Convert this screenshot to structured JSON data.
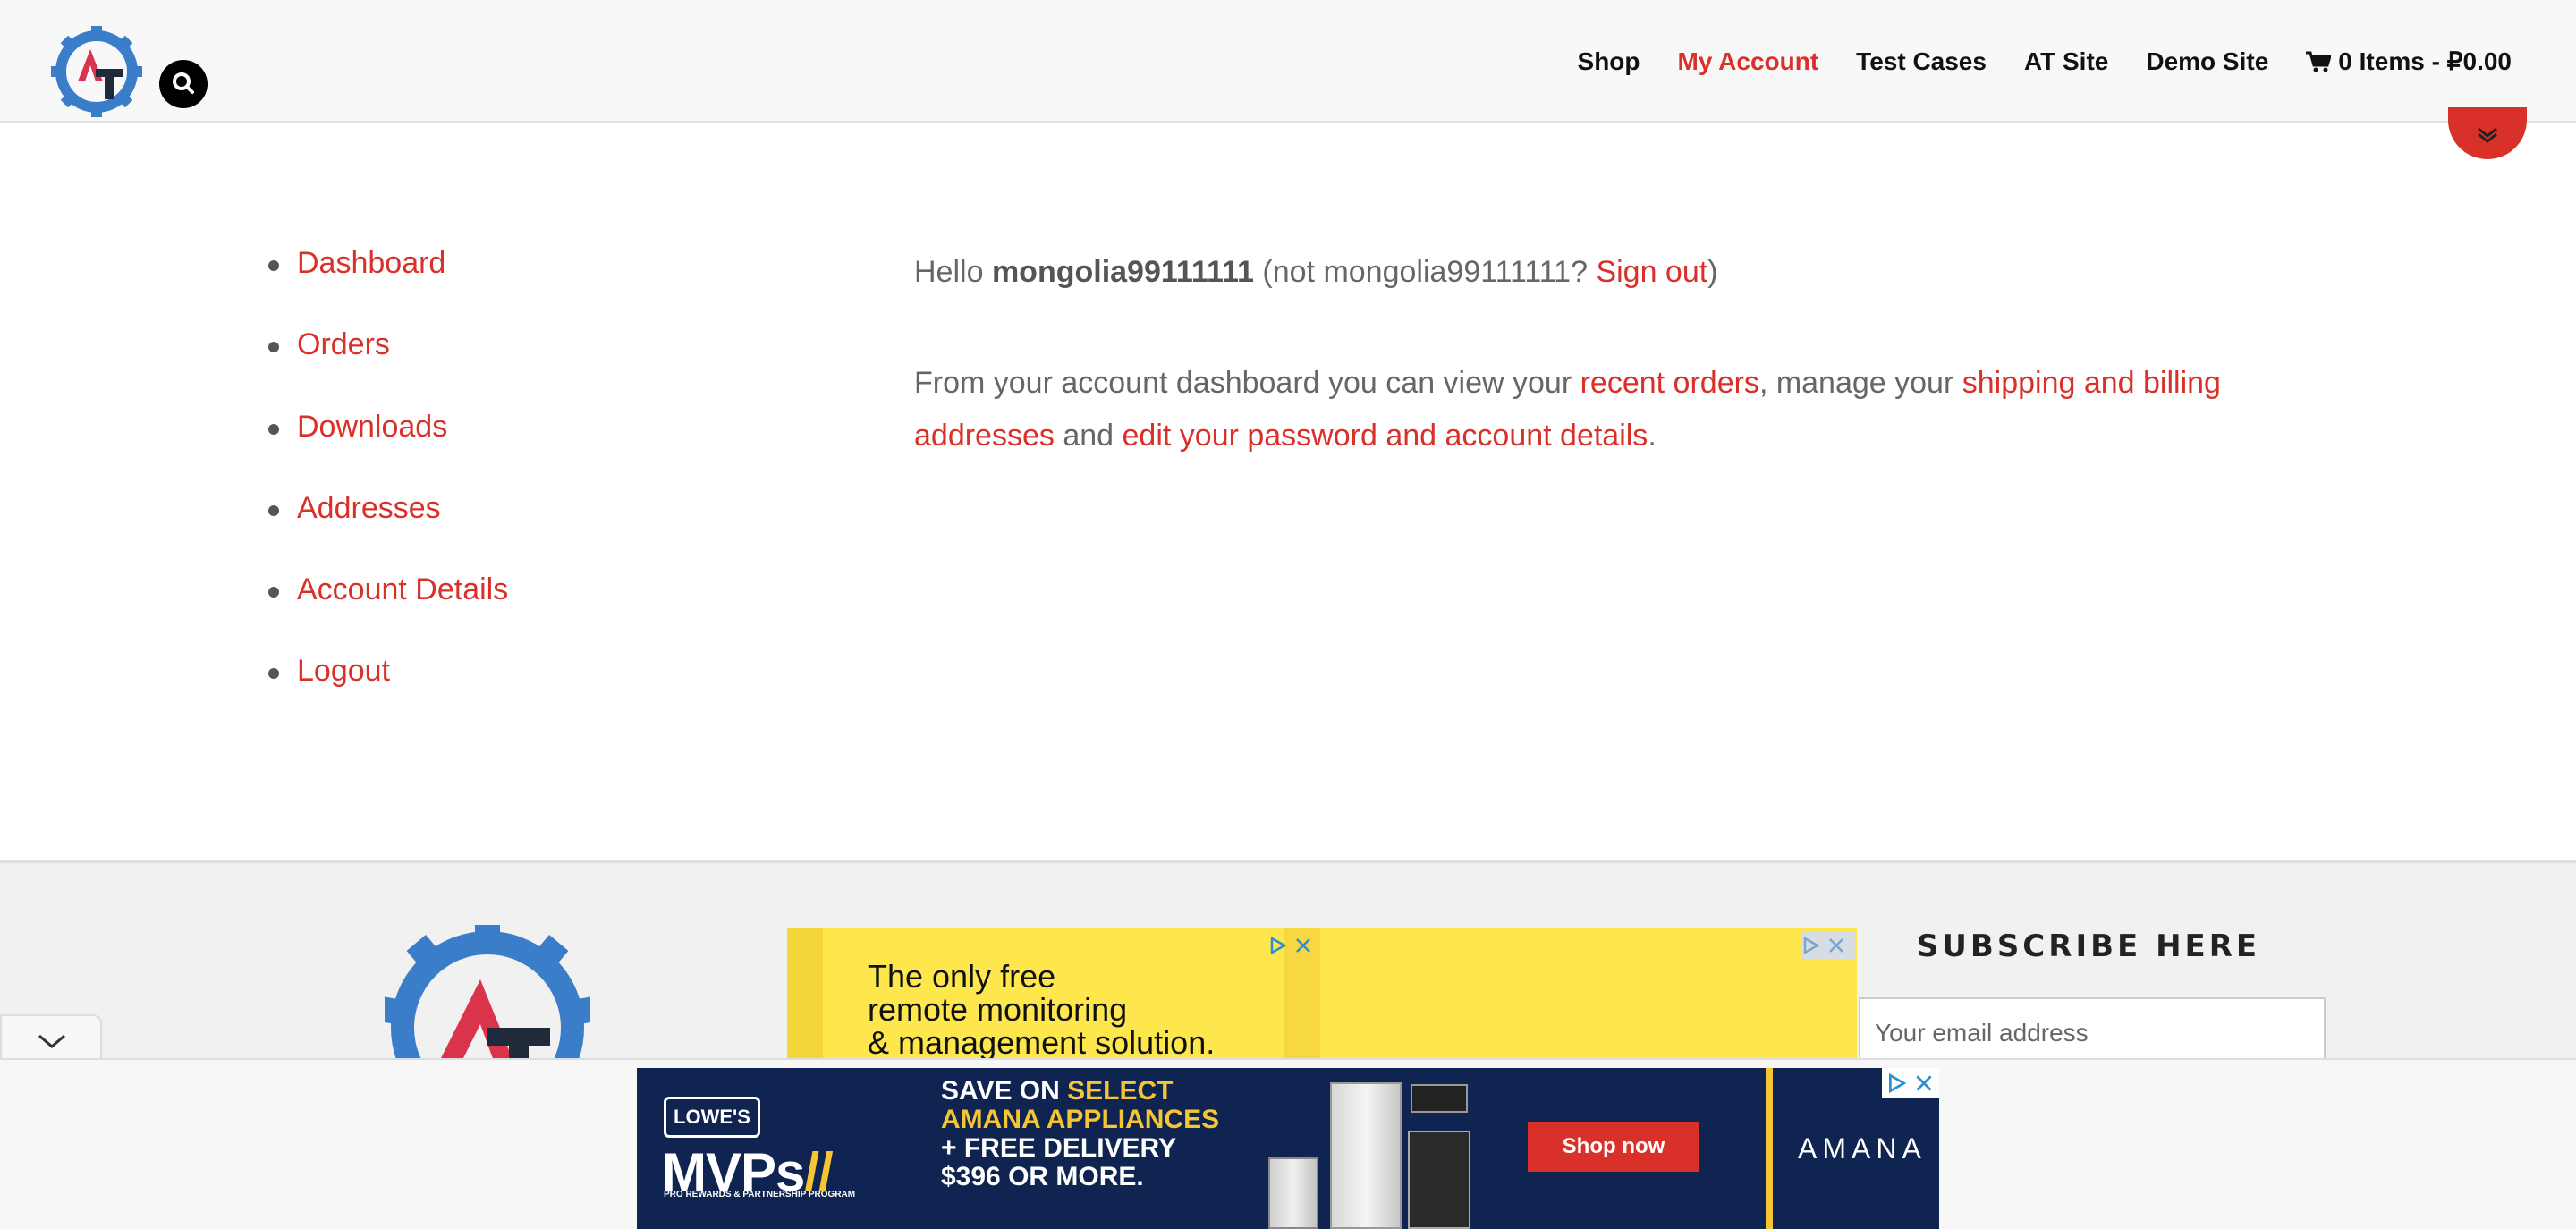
{
  "header": {
    "nav": [
      {
        "label": "Shop",
        "active": false
      },
      {
        "label": "My Account",
        "active": true
      },
      {
        "label": "Test Cases",
        "active": false
      },
      {
        "label": "AT Site",
        "active": false
      },
      {
        "label": "Demo Site",
        "active": false
      }
    ],
    "cart_label": "0 Items - ₽0.00"
  },
  "account_nav": [
    "Dashboard",
    "Orders",
    "Downloads",
    "Addresses",
    "Account Details",
    "Logout"
  ],
  "dashboard": {
    "hello": "Hello",
    "username": "mongolia99111111",
    "not_prefix": "(not mongolia99111111?",
    "sign_out": "Sign out",
    "close_paren": ")",
    "intro_1": "From your account dashboard you can view your",
    "recent_orders": "recent orders",
    "intro_2": ", manage your",
    "addresses_link": "shipping and billing addresses",
    "intro_3": "and",
    "account_link": "edit your password and account details",
    "intro_end": "."
  },
  "footer": {
    "subscribe_title": "SUBSCRIBE HERE",
    "email_placeholder": "Your email address"
  },
  "ads": {
    "footer_ad_text": [
      "The only free",
      "remote monitoring",
      "& management solution."
    ],
    "bottom_ad": {
      "brand_badge": "LOWE'S",
      "program": "MVPs",
      "program_sub": "PRO REWARDS & PARTNERSHIP PROGRAM",
      "offer_white_1": "SAVE ON ",
      "offer_yellow_1": "SELECT AMANA APPLIANCES",
      "offer_white_2": "+ FREE DELIVERY $396 OR MORE.",
      "cta": "Shop now",
      "partner": "AMANA"
    }
  },
  "colors": {
    "accent": "#d9302a",
    "ad_yellow": "#fde74c",
    "ad_navy": "#0f2451",
    "logo_blue": "#3a7dc9"
  }
}
